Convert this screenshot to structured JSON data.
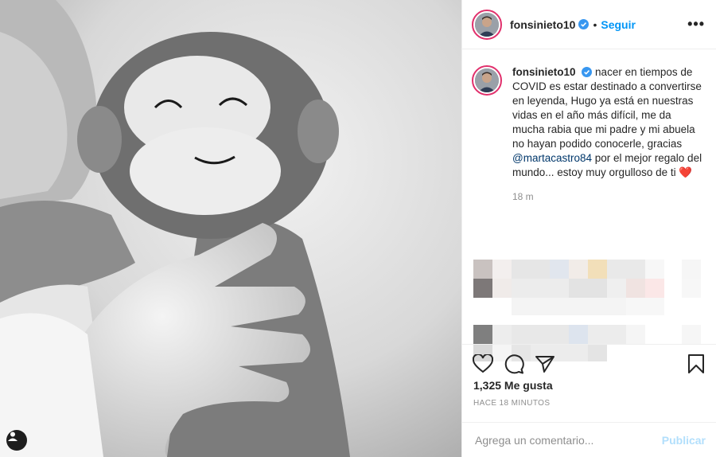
{
  "post": {
    "author": {
      "username": "fonsinieto10",
      "verified": true
    },
    "follow_label": "Seguir",
    "separator": "•",
    "more_label": "•••",
    "caption": {
      "username": "fonsinieto10",
      "text_before_mention": "nacer en tiempos de COVID es estar destinado a convertirse en leyenda, Hugo ya está en nuestras vidas en el año más difícil, me da mucha rabia que mi padre y mi abuela no hayan podido conocerle, gracias ",
      "mention": "@martacastro84",
      "text_after_mention": " por el mejor regalo del mundo... estoy muy orgulloso de ti ❤️",
      "time": "18 m"
    },
    "likes_label": "1,325 Me gusta",
    "posted_ago": "HACE 18 MINUTOS",
    "comment_placeholder": "Agrega un comentario...",
    "publish_label": "Publicar"
  },
  "icons": [
    "user-tag-icon",
    "verified-icon",
    "heart-icon",
    "comment-icon",
    "share-icon",
    "bookmark-icon",
    "more-options-icon"
  ],
  "colors": {
    "accent": "#0095f6",
    "publish_disabled": "#b2dffc",
    "muted": "#8e8e8e",
    "text": "#262626",
    "verified": "#3897f0",
    "heart": "#e0245e"
  }
}
